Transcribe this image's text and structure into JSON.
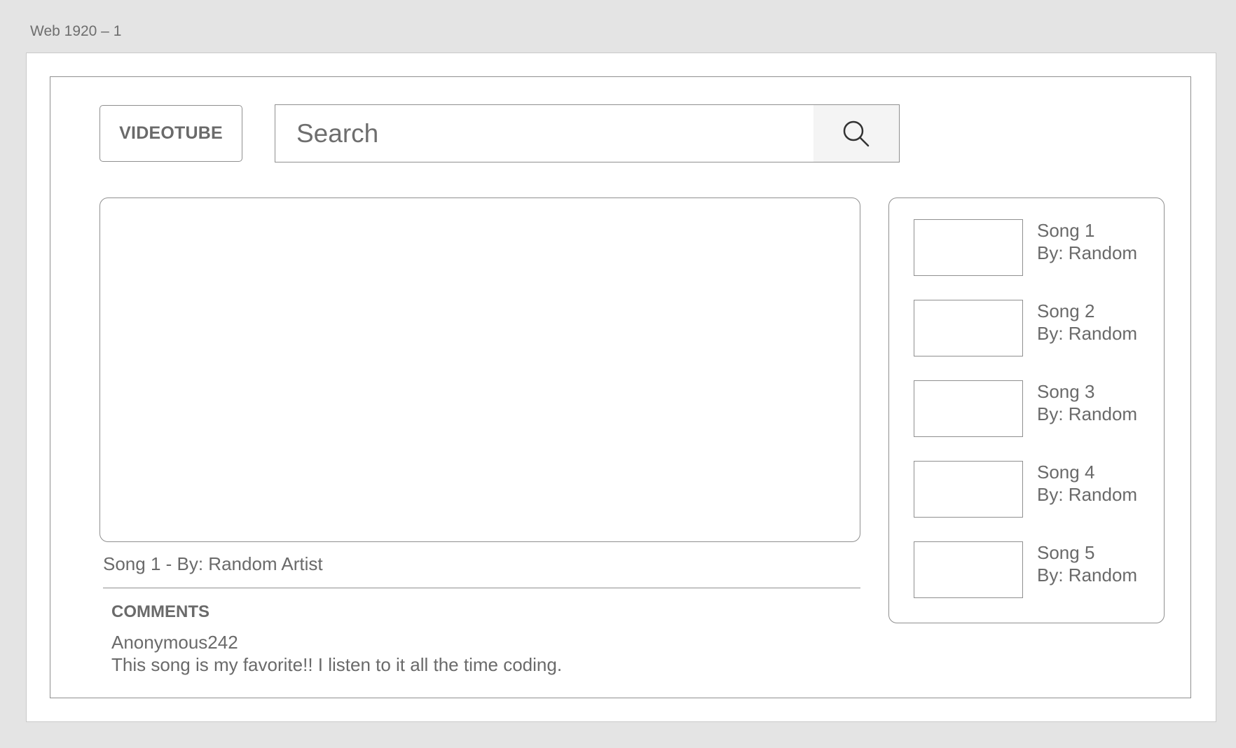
{
  "artboard": {
    "title": "Web 1920 – 1"
  },
  "header": {
    "logo_label": "VIDEOTUBE",
    "search": {
      "placeholder": "Search",
      "value": "",
      "button_icon": "search-icon"
    }
  },
  "main": {
    "video_title": "Song 1 - By: Random Artist",
    "comments": {
      "heading": "COMMENTS",
      "items": [
        {
          "author": "Anonymous242",
          "text": "This song is my favorite!! I listen to it all the time coding."
        }
      ]
    }
  },
  "sidebar": {
    "items": [
      {
        "title": "Song 1",
        "artist": "By: Random"
      },
      {
        "title": "Song 2",
        "artist": "By: Random"
      },
      {
        "title": "Song 3",
        "artist": "By: Random"
      },
      {
        "title": "Song 4",
        "artist": "By: Random"
      },
      {
        "title": "Song 5",
        "artist": "By: Random"
      }
    ]
  },
  "colors": {
    "background": "#e4e4e4",
    "border": "#8f8f8f",
    "text": "#6a6a6a",
    "search_button_bg": "#f4f4f4"
  }
}
